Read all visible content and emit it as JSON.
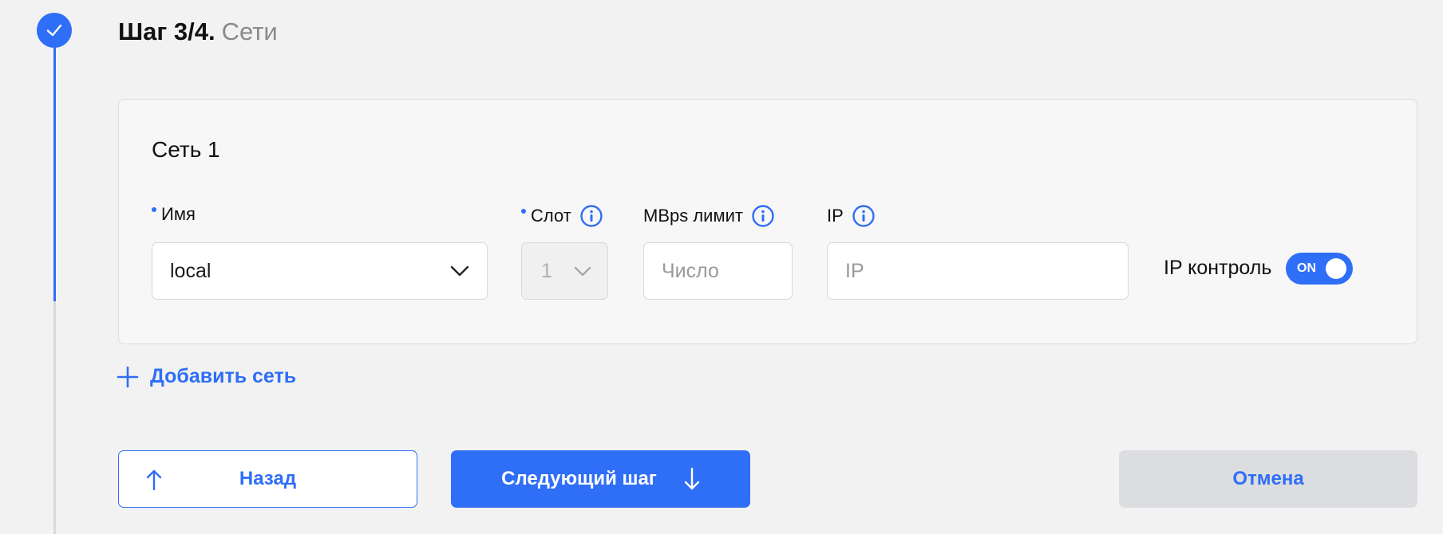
{
  "step": {
    "number": "Шаг 3/4.",
    "name": "Сети"
  },
  "network": {
    "title": "Сеть 1",
    "name_label": "Имя",
    "name_value": "local",
    "slot_label": "Слот",
    "slot_value": "1",
    "limit_label": "MBps лимит",
    "limit_placeholder": "Число",
    "ip_label": "IP",
    "ip_placeholder": "IP",
    "ip_control_label": "IP контроль",
    "ip_control_toggle": "ON"
  },
  "actions": {
    "add_network": "Добавить сеть",
    "back": "Назад",
    "next": "Следующий шаг",
    "cancel": "Отмена"
  },
  "colors": {
    "accent": "#2f6ef6",
    "progress_inactive": "#d9d9d9",
    "cancel_bg": "#dcdde0"
  }
}
